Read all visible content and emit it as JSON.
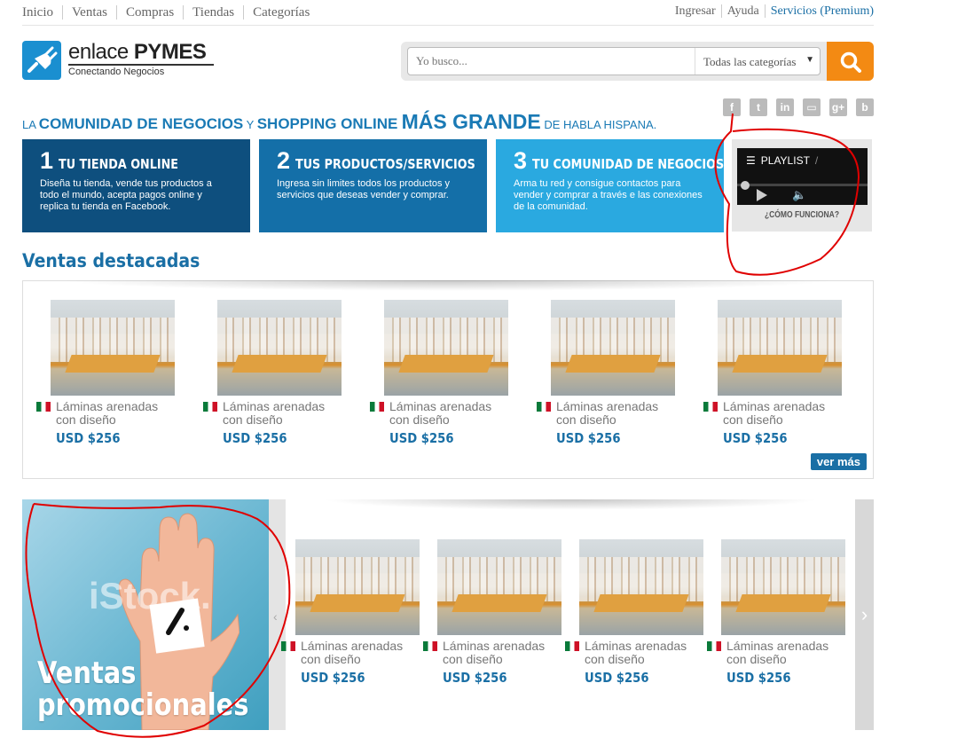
{
  "topnav": [
    "Inicio",
    "Ventas",
    "Compras",
    "Tiendas",
    "Categorías"
  ],
  "toplinks": {
    "login": "Ingresar",
    "help": "Ayuda",
    "premium": "Servicios (Premium)"
  },
  "logo": {
    "title_light": "enlace ",
    "title_bold": "PYMES",
    "subtitle": "Conectando  Negocios"
  },
  "search": {
    "placeholder": "Yo busco...",
    "category": "Todas las categorías"
  },
  "social": [
    "f",
    "t",
    "in",
    "▭",
    "g+",
    "b"
  ],
  "tagline": {
    "p1": "LA ",
    "b1": "COMUNIDAD DE NEGOCIOS",
    "p2": " Y ",
    "b2": "SHOPPING ONLINE",
    "big": "MÁS GRANDE",
    "p3": " DE HABLA HISPANA."
  },
  "steps": [
    {
      "num": "1",
      "title": "TU TIENDA ONLINE",
      "text": "Diseña tu tienda, vende tus productos a todo el mundo, acepta pagos online y replica tu tienda en Facebook."
    },
    {
      "num": "2",
      "title": "TUS PRODUCTOS/SERVICIOS",
      "text": "Ingresa sin limites todos los productos y servicios que deseas vender y comprar."
    },
    {
      "num": "3",
      "title": "TU COMUNIDAD DE NEGOCIOS",
      "text": "Arma tu red y consigue contactos para vender y comprar a través e las conexiones de la comunidad."
    }
  ],
  "video": {
    "playlist": "PLAYLIST",
    "divider": "/",
    "link": "¿CÓMO FUNCIONA?"
  },
  "featured": {
    "title": "Ventas destacadas",
    "more": "ver más",
    "products": [
      {
        "name": "Láminas arenadas con diseño",
        "price": "USD $256"
      },
      {
        "name": "Láminas arenadas con diseño",
        "price": "USD $256"
      },
      {
        "name": "Láminas arenadas con diseño",
        "price": "USD $256"
      },
      {
        "name": "Láminas arenadas con diseño",
        "price": "USD $256"
      },
      {
        "name": "Láminas arenadas con diseño",
        "price": "USD $256"
      }
    ]
  },
  "promo": {
    "title_line1": "Ventas",
    "title_line2": "promocionales",
    "watermark": "iStock.",
    "products": [
      {
        "name": "Láminas arenadas con diseño",
        "price": "USD $256"
      },
      {
        "name": "Láminas arenadas con diseño",
        "price": "USD $256"
      },
      {
        "name": "Láminas arenadas con diseño",
        "price": "USD $256"
      },
      {
        "name": "Láminas arenadas con diseño",
        "price": "USD $256"
      }
    ]
  },
  "colors": {
    "brand_blue": "#1a6fa5",
    "search_orange": "#f38a13",
    "annotation_red": "#e00000"
  }
}
